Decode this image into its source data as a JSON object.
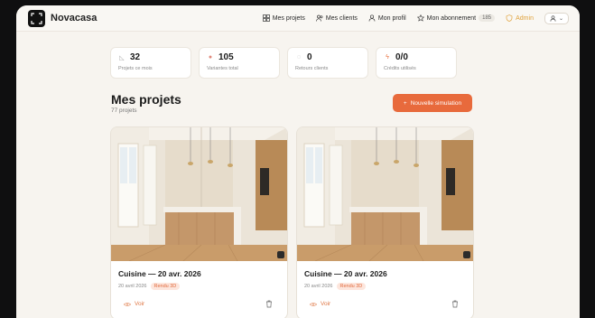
{
  "app": {
    "name": "Novacasa"
  },
  "nav": {
    "projects": "Mes projets",
    "clients": "Mes clients",
    "profile": "Mon profil",
    "subscription": "Mon abonnement",
    "subscription_count": "185",
    "admin": "Admin"
  },
  "stats": [
    {
      "value": "32",
      "label": "Projets ce mois",
      "icon": "chart-icon"
    },
    {
      "value": "105",
      "label": "Variantes total",
      "icon": "palette-icon"
    },
    {
      "value": "0",
      "label": "Retours clients",
      "icon": "chat-icon"
    },
    {
      "value": "0/0",
      "label": "Crédits utilisés",
      "icon": "bolt-icon"
    }
  ],
  "projects": {
    "title": "Mes projets",
    "count": "77 projets",
    "new_button": "Nouvelle simulation"
  },
  "cards": [
    {
      "title": "Cuisine — 20 avr. 2026",
      "date": "20 avril 2026",
      "badge": "Rendu 3D",
      "view": "Voir"
    },
    {
      "title": "Cuisine — 20 avr. 2026",
      "date": "20 avril 2026",
      "badge": "Rendu 3D",
      "view": "Voir"
    }
  ],
  "colors": {
    "accent": "#e86a3c",
    "admin": "#e0a23c",
    "background": "#f7f4ef"
  }
}
